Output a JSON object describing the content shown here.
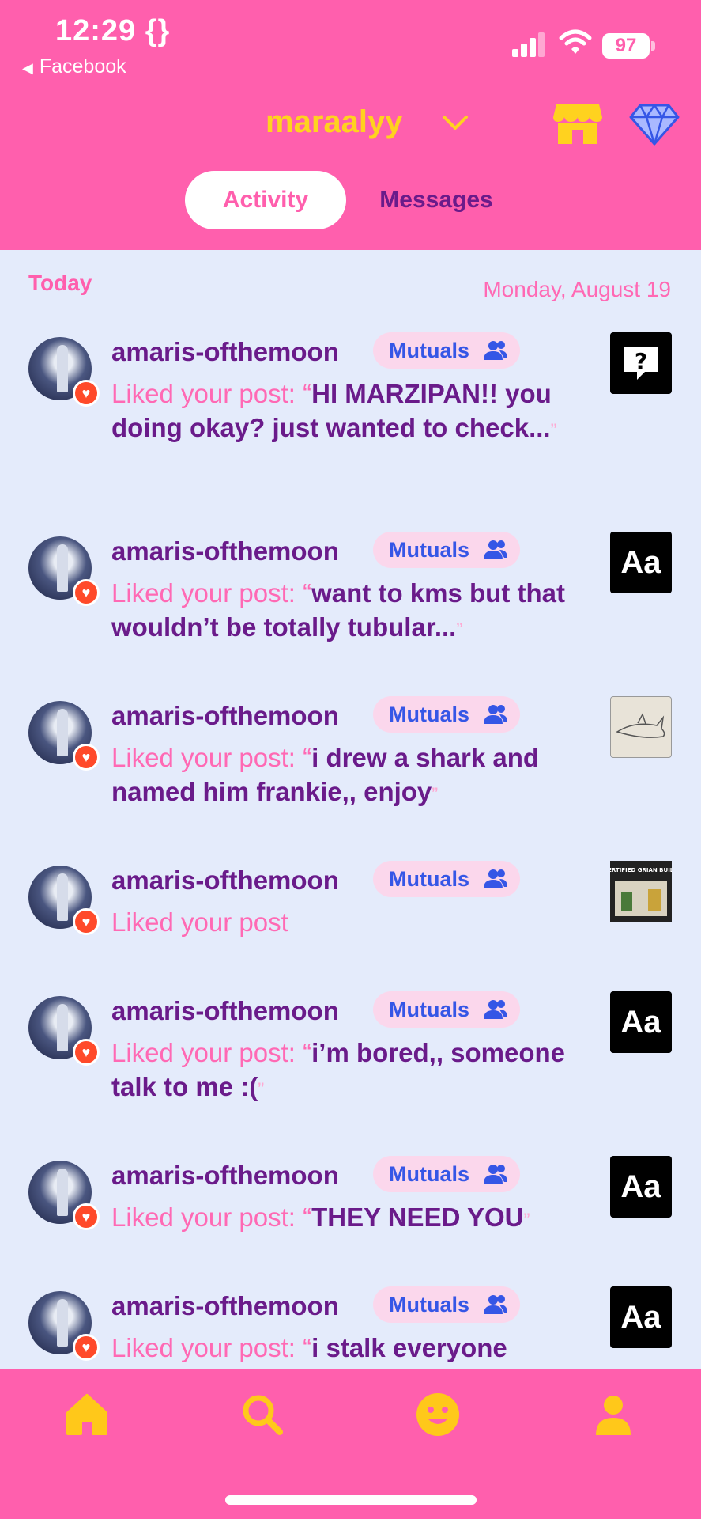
{
  "status": {
    "time": "12:29 {}",
    "back_app": "Facebook",
    "battery": "97"
  },
  "header": {
    "blog_name": "maraalyy",
    "accent": "#ff5fad",
    "title_color": "#ffd21f"
  },
  "tabs": [
    {
      "label": "Activity",
      "selected": true
    },
    {
      "label": "Messages",
      "selected": false
    }
  ],
  "section": {
    "label": "Today",
    "date": "Monday, August 19"
  },
  "activity": [
    {
      "user": "amaris-ofthemoon",
      "badge": "Mutuals",
      "action": "Liked your post: ",
      "post": "HI MARZIPAN!! you doing okay? just wanted to check...",
      "thumb": "question-icon"
    },
    {
      "user": "amaris-ofthemoon",
      "badge": "Mutuals",
      "action": "Liked your post: ",
      "post": "want to kms but that wouldn’t be totally tubular...",
      "thumb": "Aa"
    },
    {
      "user": "amaris-ofthemoon",
      "badge": "Mutuals",
      "action": "Liked your post: ",
      "post": "i drew a shark and named him frankie,, enjoy",
      "thumb": "shark-drawing"
    },
    {
      "user": "amaris-ofthemoon",
      "badge": "Mutuals",
      "action": "Liked your post",
      "post": "",
      "thumb": "build-photo"
    },
    {
      "user": "amaris-ofthemoon",
      "badge": "Mutuals",
      "action": "Liked your post: ",
      "post": "i’m bored,, someone talk to me :(",
      "thumb": "Aa"
    },
    {
      "user": "amaris-ofthemoon",
      "badge": "Mutuals",
      "action": "Liked your post: ",
      "post": "THEY NEED YOU",
      "thumb": "Aa"
    },
    {
      "user": "amaris-ofthemoon",
      "badge": "Mutuals",
      "action": "Liked your post: ",
      "post": "i stalk everyone",
      "thumb": "Aa"
    }
  ],
  "thumb_text": {
    "aa": "Aa",
    "build_caption": "CERTIFIED GRIAN BUILD"
  },
  "nav": [
    "home-icon",
    "search-icon",
    "activity-face-icon",
    "account-icon"
  ]
}
